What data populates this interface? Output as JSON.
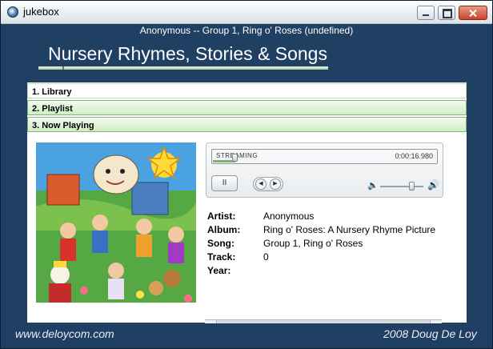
{
  "window": {
    "title": "jukebox"
  },
  "now_playing_line": "Anonymous -- Group 1, Ring o' Roses (undefined)",
  "app_title": "Nursery Rhymes, Stories & Songs",
  "accordion": {
    "library": "1. Library",
    "playlist": "2. Playlist",
    "now_playing": "3. Now Playing"
  },
  "player": {
    "status": "STREAMING",
    "time": "0:00:16.980",
    "progress_fraction": 0.1,
    "volume_fraction": 0.72,
    "pause_symbol": "II",
    "prev_symbol": "◀",
    "next_symbol": "▶"
  },
  "track_info": {
    "artist_label": "Artist:",
    "artist": "Anonymous",
    "album_label": "Album:",
    "album": "Ring o' Roses: A Nursery Rhyme Picture",
    "song_label": "Song:",
    "song": "Group 1, Ring o' Roses",
    "track_label": "Track:",
    "track": "0",
    "year_label": "Year:",
    "year": ""
  },
  "footer": {
    "left": "www.deloycom.com",
    "right": "2008 Doug De Loy"
  },
  "icons": {
    "app": "jukebox-globe-icon",
    "volume_low": "speaker-low-icon",
    "volume_high": "speaker-high-icon"
  }
}
